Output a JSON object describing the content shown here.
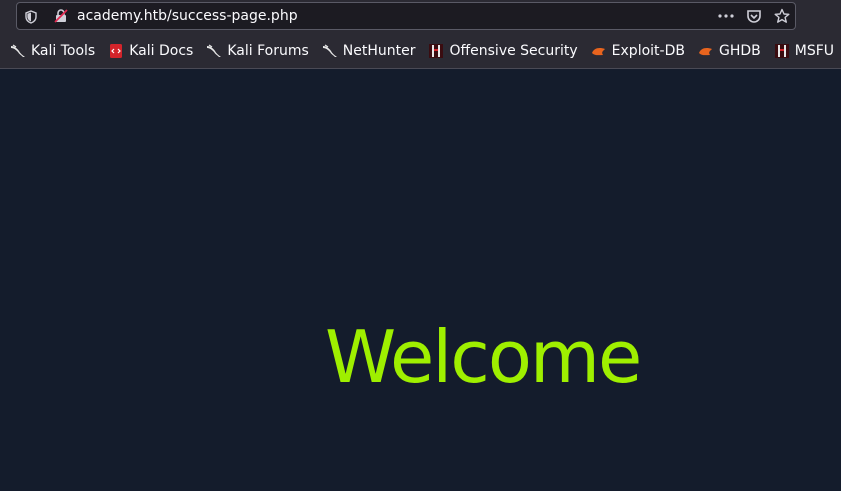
{
  "browser": {
    "url": "academy.htb/success-page.php",
    "icons": {
      "shield": "shield-icon",
      "lock": "insecure-lock-icon",
      "more": "more-dots-icon",
      "pocket": "pocket-icon",
      "bookmark": "star-icon"
    }
  },
  "bookmarks": [
    {
      "label": "Kali Tools",
      "icon": "kali-dragon-icon"
    },
    {
      "label": "Kali Docs",
      "icon": "kali-docs-icon"
    },
    {
      "label": "Kali Forums",
      "icon": "kali-dragon-icon"
    },
    {
      "label": "NetHunter",
      "icon": "kali-dragon-icon"
    },
    {
      "label": "Offensive Security",
      "icon": "offsec-icon"
    },
    {
      "label": "Exploit-DB",
      "icon": "exploit-db-icon"
    },
    {
      "label": "GHDB",
      "icon": "exploit-db-icon"
    },
    {
      "label": "MSFU",
      "icon": "offsec-icon"
    }
  ],
  "page": {
    "heading": "Welcome",
    "background": "#141c2c",
    "heading_color": "#9fef00"
  }
}
